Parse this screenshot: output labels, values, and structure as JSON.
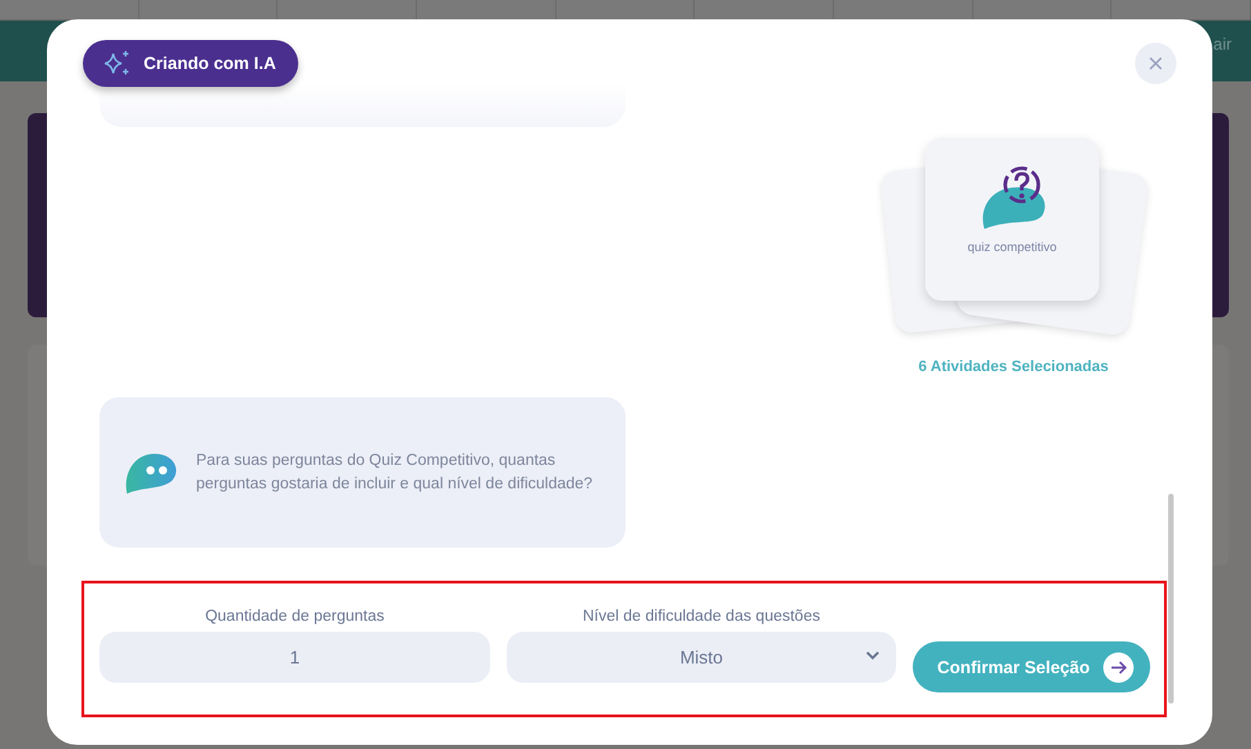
{
  "backdrop": {
    "header_action": "air"
  },
  "modal": {
    "badge": "Criando com I.A",
    "activity_card": {
      "label": "quiz competitivo"
    },
    "selected_count": "6 Atividades Selecionadas",
    "bot_message": "Para suas perguntas do Quiz Competitivo, quantas perguntas gostaria de incluir e qual nível de dificuldade?",
    "form": {
      "quantity": {
        "label": "Quantidade de perguntas",
        "value": "1"
      },
      "difficulty": {
        "label": "Nível de dificuldade das questões",
        "value": "Misto"
      },
      "confirm_button": "Confirmar Seleção"
    }
  }
}
